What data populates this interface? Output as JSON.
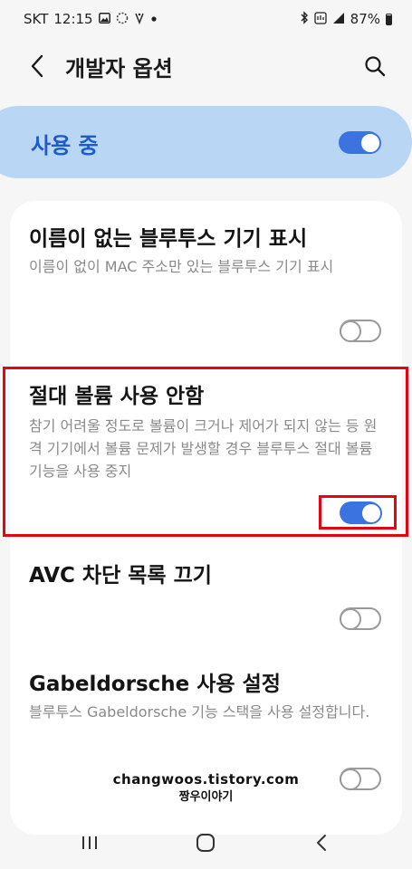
{
  "status_bar": {
    "carrier": "SKT",
    "time": "12:15",
    "battery_text": "87%",
    "icons_left": [
      "gallery-icon",
      "loading-icon",
      "mail-icon",
      "dot-icon"
    ],
    "icons_right": [
      "bluetooth-icon",
      "hotspot-icon",
      "signal-icon",
      "battery-icon"
    ]
  },
  "header": {
    "title": "개발자 옵션",
    "back_icon": "chevron-left-icon",
    "search_icon": "search-icon"
  },
  "master_switch": {
    "label": "사용 중",
    "checked": true
  },
  "settings": [
    {
      "title": "이름이 없는 블루투스 기기 표시",
      "description": "이름이 없이 MAC 주소만 있는 블루투스 기기 표시",
      "checked": false
    },
    {
      "title": "절대 볼륨 사용 안함",
      "description": "참기 어려울 정도로 볼륨이 크거나 제어가 되지 않는 등 원격 기기에서 볼륨 문제가 발생할 경우 블루투스 절대 볼륨 기능을 사용 중지",
      "checked": true
    },
    {
      "title": "AVC 차단 목록 끄기",
      "description": "",
      "checked": false
    },
    {
      "title": "Gabeldorsche 사용 설정",
      "description": "블루투스 Gabeldorsche 기능 스택을 사용 설정합니다.",
      "checked": false
    }
  ],
  "watermark": {
    "line1": "changwoos.tistory.com",
    "line2": "짱우이야기"
  },
  "nav_bar": {
    "buttons": [
      "recent-apps-icon",
      "home-icon",
      "back-icon"
    ]
  },
  "colors": {
    "accent": "#3b74e0",
    "master_bg": "#b9d6f5",
    "master_text": "#1c5bc8",
    "highlight": "#e20613"
  }
}
